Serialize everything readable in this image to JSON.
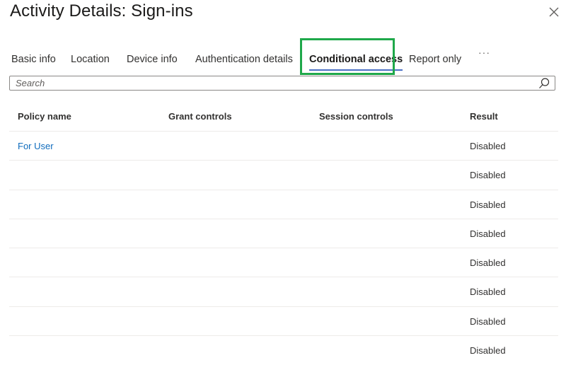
{
  "header": {
    "title": "Activity Details: Sign-ins"
  },
  "tabs": [
    {
      "label": "Basic info"
    },
    {
      "label": "Location"
    },
    {
      "label": "Device info"
    },
    {
      "label": "Authentication details"
    },
    {
      "label": "Conditional access",
      "active": true
    },
    {
      "label": "Report only"
    }
  ],
  "tabs_more": "···",
  "search": {
    "placeholder": "Search",
    "value": ""
  },
  "table": {
    "columns": [
      "Policy name",
      "Grant controls",
      "Session controls",
      "Result"
    ],
    "rows": [
      {
        "policy": "For User",
        "grant": "",
        "session": "",
        "result": "Disabled"
      },
      {
        "policy": "",
        "grant": "",
        "session": "",
        "result": "Disabled"
      },
      {
        "policy": "",
        "grant": "",
        "session": "",
        "result": "Disabled"
      },
      {
        "policy": "",
        "grant": "",
        "session": "",
        "result": "Disabled"
      },
      {
        "policy": "",
        "grant": "",
        "session": "",
        "result": "Disabled"
      },
      {
        "policy": "",
        "grant": "",
        "session": "",
        "result": "Disabled"
      },
      {
        "policy": "",
        "grant": "",
        "session": "",
        "result": "Disabled"
      },
      {
        "policy": "",
        "grant": "",
        "session": "",
        "result": "Disabled"
      }
    ]
  },
  "colors": {
    "link": "#0f6cbd",
    "active_underline": "#4a6fc4",
    "highlight": "#1fa84a"
  },
  "icons": {
    "close": "close-icon",
    "search": "search-icon"
  }
}
